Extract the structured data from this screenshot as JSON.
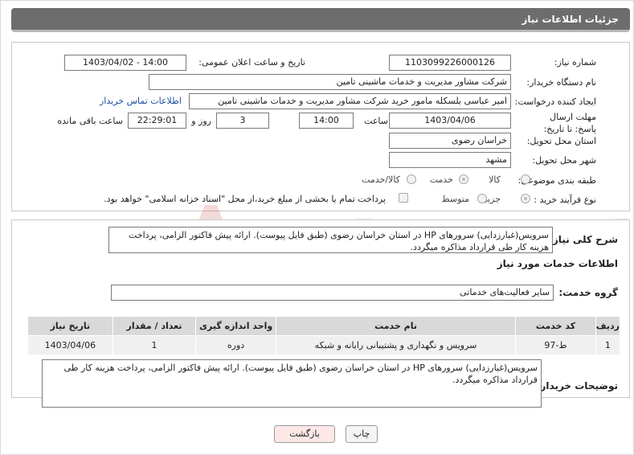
{
  "title": "جزئیات اطلاعات نیاز",
  "form": {
    "need_number_label": "شماره نیاز:",
    "need_number": "1103099226000126",
    "announce_label": "تاریخ و ساعت اعلان عمومی:",
    "announce_value": "1403/04/02 - 14:00",
    "buyer_org_label": "نام دستگاه خریدار:",
    "buyer_org": "شرکت مشاور مدیریت و خدمات ماشینی تامین",
    "creator_label": "ایجاد کننده درخواست:",
    "creator": "امیر عباسی بلسکله مامور خرید شرکت مشاور مدیریت و خدمات ماشینی تامین",
    "contact_link": "اطلاعات تماس خریدار",
    "deadline_label": "مهلت ارسال پاسخ: تا تاریخ:",
    "deadline_date": "1403/04/06",
    "time_label": "ساعت",
    "deadline_time": "14:00",
    "days_value": "3",
    "days_label": "روز و",
    "remaining_time": "22:29:01",
    "remaining_label": "ساعت باقی مانده",
    "province_label": "استان محل تحویل:",
    "province": "خراسان رضوی",
    "city_label": "شهر محل تحویل:",
    "city": "مشهد",
    "category_label": "طبقه بندی موضوعی:",
    "category_options": [
      "کالا",
      "خدمت",
      "کالا/خدمت"
    ],
    "category_selected": "خدمت",
    "process_label": "نوع فرآیند خرید :",
    "process_options": [
      "جزیی",
      "متوسط"
    ],
    "process_selected": "جزیی",
    "treasury_note": "پرداخت تمام یا بخشی از مبلغ خرید،از محل \"اسناد خزانه اسلامی\" خواهد بود."
  },
  "summary": {
    "label": "شرح کلی نیاز:",
    "text": "سرویس(غبارزدایی) سرورهای HP در استان خراسان رضوی (طبق فایل پیوست). ارائه پیش فاکتور الزامی، پرداخت هزینه کار طی قرارداد مذاکره میگردد."
  },
  "services": {
    "section_title": "اطلاعات خدمات مورد نیاز",
    "group_label": "گروه خدمت:",
    "group_value": "سایر فعالیت‌های خدماتی",
    "columns": [
      "ردیف",
      "کد خدمت",
      "نام خدمت",
      "واحد اندازه گیری",
      "تعداد / مقدار",
      "تاریخ نیاز"
    ],
    "rows": [
      [
        "1",
        "ط-97",
        "سرویس و نگهداری و پشتیبانی رایانه و شبکه",
        "دوره",
        "1",
        "1403/04/06"
      ]
    ]
  },
  "buyer_notes": {
    "label": "توضیحات خریدار:",
    "text": "سرویس(غبارزدایی) سرورهای HP در استان خراسان رضوی (طبق فایل پیوست). ارائه پیش فاکتور الزامی، پرداخت هزینه کار طی قرارداد مذاکره میگردد."
  },
  "buttons": {
    "print": "چاپ",
    "back": "بازگشت"
  },
  "watermark": "AriaTender.neT",
  "colors": {
    "title_bg": "#6d6d6d",
    "link": "#1a4fa0",
    "back_button": "#fde7e7"
  }
}
